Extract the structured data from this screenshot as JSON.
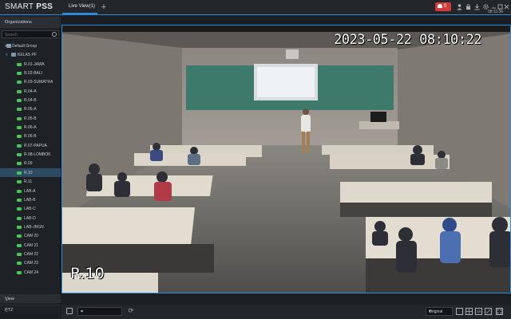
{
  "app": {
    "title_light": "SMART ",
    "title_bold": "PSS",
    "tab_label": "Live View(1)",
    "add_tab_glyph": "+",
    "alarm_count": "0",
    "clock": "08:11:36",
    "accent_color": "#2b8ad9",
    "alarm_color": "#d23b3b"
  },
  "sidebar": {
    "organizations_label": "Organizations",
    "search_placeholder": "Search",
    "default_group": "Default Group",
    "folder": "KELAS PF",
    "items": [
      "R.01-JAWA",
      "R.02-BALI",
      "R.03-SUMATRA",
      "R.04-A",
      "R.04-B",
      "R.05-A",
      "R.05-B",
      "R.06-A",
      "R.06-B",
      "R.07-PAPUA",
      "R.08-LOMBOK",
      "R.09",
      "R.10",
      "R.11",
      "LAB-A",
      "LAB-B",
      "LAB-C",
      "LAB-D",
      "LAB-JRGN",
      "CAM 20",
      "CAM 21",
      "CAM 22",
      "CAM 23",
      "CAM 24"
    ],
    "selected_item": "R.10",
    "view_label": "View",
    "ptz_label": "PTZ"
  },
  "video": {
    "osd_timestamp": "2023-05-22 08:10:22",
    "osd_channel": "R.10"
  },
  "toolbar": {
    "stream_select_value": "--",
    "ratio_value": "Original",
    "layout_icon_label": "16"
  },
  "icons": {
    "alarm": "bell-icon",
    "user": "user-icon",
    "lock": "lock-icon",
    "download": "download-icon",
    "settings": "gear-icon",
    "minimize": "minimize-icon",
    "maximize": "maximize-icon",
    "close": "close-icon"
  }
}
